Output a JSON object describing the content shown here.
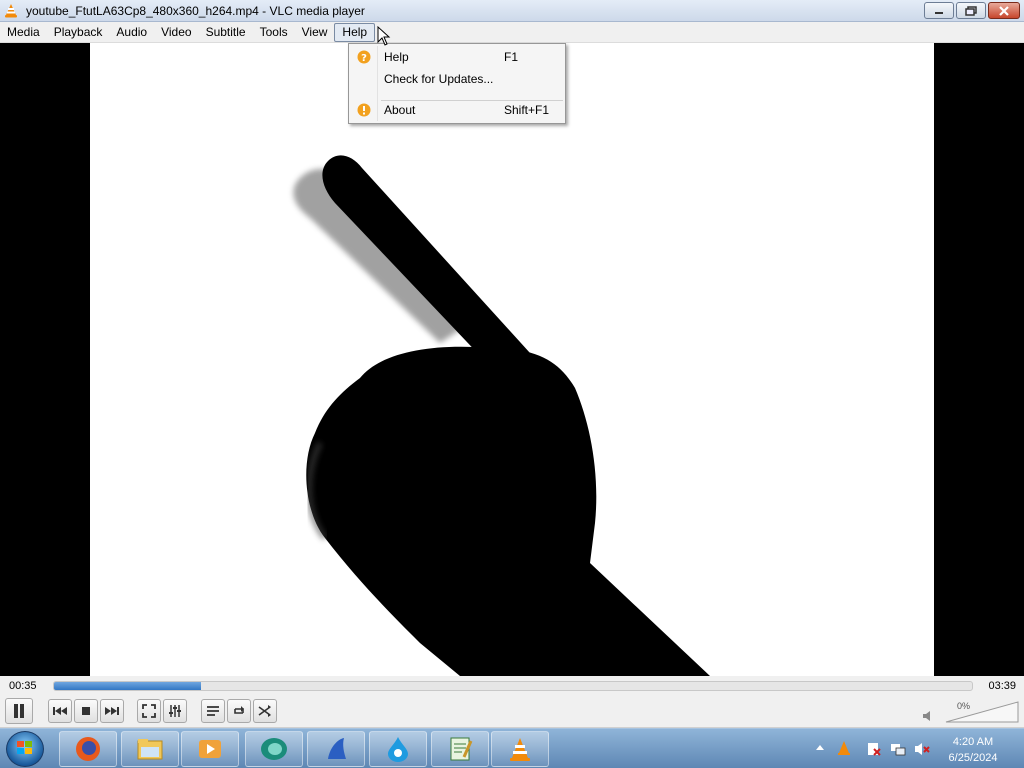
{
  "window": {
    "title": "youtube_FtutLA63Cp8_480x360_h264.mp4 - VLC media player",
    "icons": [
      "vlc-cone-icon",
      "minimize-icon",
      "maximize-icon",
      "close-icon"
    ]
  },
  "menubar": {
    "items": [
      {
        "label": "Media"
      },
      {
        "label": "Playback"
      },
      {
        "label": "Audio"
      },
      {
        "label": "Video"
      },
      {
        "label": "Subtitle"
      },
      {
        "label": "Tools"
      },
      {
        "label": "View"
      },
      {
        "label": "Help",
        "active": true
      }
    ]
  },
  "help_menu": {
    "items": [
      {
        "label": "Help",
        "shortcut": "F1",
        "icon": "help-question-icon"
      },
      {
        "label": "Check for Updates...",
        "shortcut": "",
        "icon": ""
      },
      {
        "label": "About",
        "shortcut": "Shift+F1",
        "icon": "info-icon"
      }
    ]
  },
  "player": {
    "elapsed": "00:35",
    "total": "03:39",
    "progress_fraction": 0.16,
    "volume_label": "0%",
    "volume_fraction": 0.0
  },
  "controls": {
    "icons": [
      "pause-icon",
      "previous-icon",
      "stop-icon",
      "next-icon",
      "fullscreen-icon",
      "extended-settings-icon",
      "playlist-icon",
      "loop-icon",
      "shuffle-icon",
      "speaker-icon"
    ]
  },
  "taskbar": {
    "apps": [
      "firefox-icon",
      "file-explorer-icon",
      "media-player-icon",
      "browser-icon",
      "sail-app-icon",
      "water-drop-icon",
      "notepad-icon",
      "vlc-icon"
    ],
    "clock_time": "4:20 AM",
    "clock_date": "6/25/2024"
  },
  "colors": {
    "accent": "#3377c4",
    "vlc_orange": "#f28a0a",
    "taskbar": "#5e87b4"
  }
}
